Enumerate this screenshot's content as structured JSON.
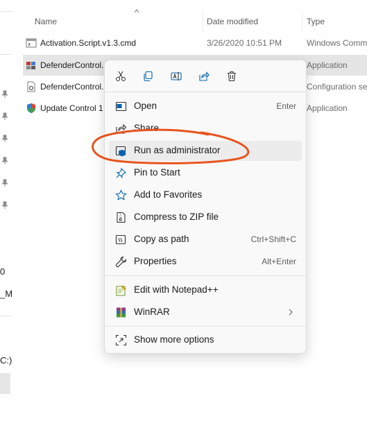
{
  "explorer": {
    "columns": {
      "name": "Name",
      "date": "Date modified",
      "type": "Type"
    },
    "files": [
      {
        "name": "Activation.Script.v1.3.cmd",
        "date": "3/26/2020 10:51 PM",
        "type": "Windows Comm",
        "icon": "cmd-file-icon"
      },
      {
        "name": "DefenderControl.",
        "date": "",
        "type": "Application",
        "icon": "defender-app-icon",
        "selected": true
      },
      {
        "name": "DefenderControl.",
        "date": "",
        "type": "Configuration se",
        "icon": "ini-file-icon"
      },
      {
        "name": "Update Control 1",
        "date": "",
        "type": "Application",
        "icon": "update-app-icon"
      }
    ]
  },
  "nav_pane": {
    "fragments": [
      "0",
      "_M",
      "C:)"
    ]
  },
  "context_menu": {
    "items": [
      {
        "label": "Open",
        "shortcut": "Enter",
        "icon": "open-icon"
      },
      {
        "label": "Share",
        "shortcut": "",
        "icon": "share-icon"
      },
      {
        "label": "Run as administrator",
        "shortcut": "",
        "icon": "shield-icon"
      },
      {
        "label": "Pin to Start",
        "shortcut": "",
        "icon": "pin-icon"
      },
      {
        "label": "Add to Favorites",
        "shortcut": "",
        "icon": "star-icon"
      },
      {
        "label": "Compress to ZIP file",
        "shortcut": "",
        "icon": "zip-icon"
      },
      {
        "label": "Copy as path",
        "shortcut": "Ctrl+Shift+C",
        "icon": "copy-path-icon"
      },
      {
        "label": "Properties",
        "shortcut": "Alt+Enter",
        "icon": "wrench-icon"
      }
    ],
    "extras": [
      {
        "label": "Edit with Notepad++",
        "icon": "notepadpp-icon"
      },
      {
        "label": "WinRAR",
        "icon": "winrar-icon"
      }
    ],
    "more": {
      "label": "Show more options",
      "icon": "more-options-icon"
    },
    "toolbar": [
      "cut-icon",
      "copy-icon",
      "rename-icon",
      "share-icon",
      "delete-icon"
    ]
  },
  "colors": {
    "annotation": "#e8541c",
    "selected_row": "#e5e5e5",
    "accent": "#0063b1"
  }
}
